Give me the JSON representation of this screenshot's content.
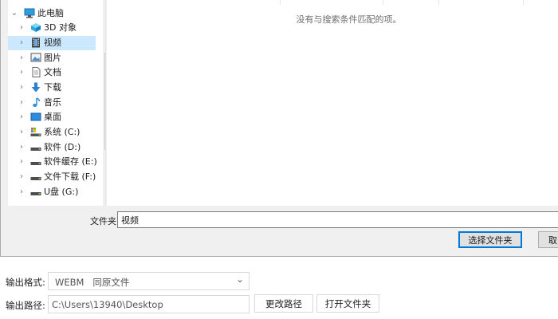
{
  "dialog": {
    "tree": [
      {
        "label": "此电脑",
        "icon": "computer-icon",
        "expanded": true
      },
      {
        "label": "3D 对象",
        "icon": "3d-objects-icon"
      },
      {
        "label": "视频",
        "icon": "video-icon",
        "selected": true
      },
      {
        "label": "图片",
        "icon": "pictures-icon"
      },
      {
        "label": "文档",
        "icon": "document-icon"
      },
      {
        "label": "下载",
        "icon": "download-icon"
      },
      {
        "label": "音乐",
        "icon": "music-icon"
      },
      {
        "label": "桌面",
        "icon": "desktop-icon"
      },
      {
        "label": "系统 (C:)",
        "icon": "system-drive-icon"
      },
      {
        "label": "软件 (D:)",
        "icon": "drive-icon"
      },
      {
        "label": "软件缓存 (E:)",
        "icon": "drive-icon"
      },
      {
        "label": "文件下载 (F:)",
        "icon": "drive-icon"
      },
      {
        "label": "U盘 (G:)",
        "icon": "drive-icon"
      }
    ],
    "empty_message": "没有与搜索条件匹配的项。",
    "folder_label": "文件夹:",
    "folder_value": "视频",
    "select_button": "选择文件夹",
    "cancel_button": "取"
  },
  "form": {
    "format_label": "输出格式:",
    "format_value": "WEBM   同原文件",
    "path_label": "输出路径:",
    "path_value": "C:\\Users\\13940\\Desktop",
    "change_path_button": "更改路径",
    "open_folder_button": "打开文件夹"
  },
  "colors": {
    "selection": "#cce8ff",
    "accent": "#0078d7"
  }
}
